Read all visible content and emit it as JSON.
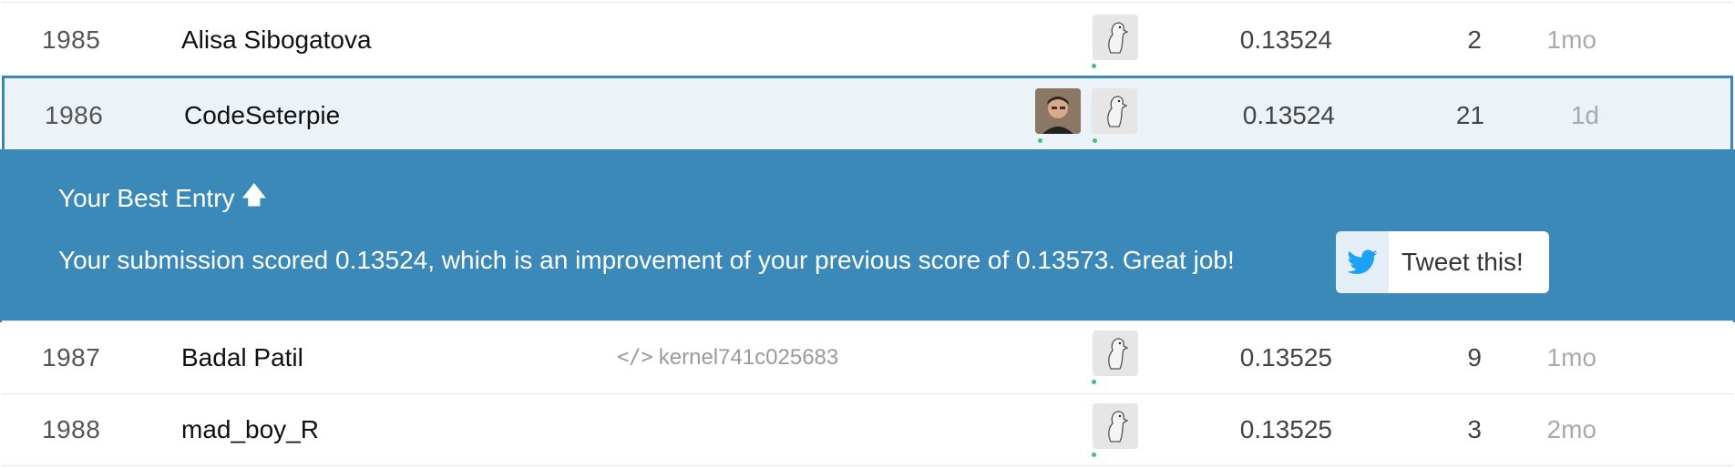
{
  "rows_top": [
    {
      "rank": "1985",
      "team": "Alisa Sibogatova",
      "kernel": "",
      "score": "0.13524",
      "entries": "2",
      "last": "1mo"
    },
    {
      "rank": "1986",
      "team": "CodeSeterpie",
      "kernel": "",
      "score": "0.13524",
      "entries": "21",
      "last": "1d"
    }
  ],
  "banner": {
    "title": "Your Best Entry",
    "arrow": "🡅",
    "message": "Your submission scored 0.13524, which is an improvement of your previous score of 0.13573. Great job!",
    "tweet_label": "Tweet this!"
  },
  "rows_bottom": [
    {
      "rank": "1987",
      "team": "Badal Patil",
      "kernel": "kernel741c025683",
      "score": "0.13525",
      "entries": "9",
      "last": "1mo"
    },
    {
      "rank": "1988",
      "team": "mad_boy_R",
      "kernel": "",
      "score": "0.13525",
      "entries": "3",
      "last": "2mo"
    }
  ],
  "kernel_icon": "</>",
  "colors": {
    "banner_bg": "#3b89b9",
    "highlight_row_bg": "#ebf2f8",
    "highlight_border": "#3a87b7",
    "twitter_blue": "#1da1f2",
    "online_dot": "#3fc17b"
  },
  "icons": [
    "goose-avatar-icon",
    "user-photo-avatar",
    "code-icon",
    "up-arrow-icon",
    "twitter-bird-icon"
  ]
}
